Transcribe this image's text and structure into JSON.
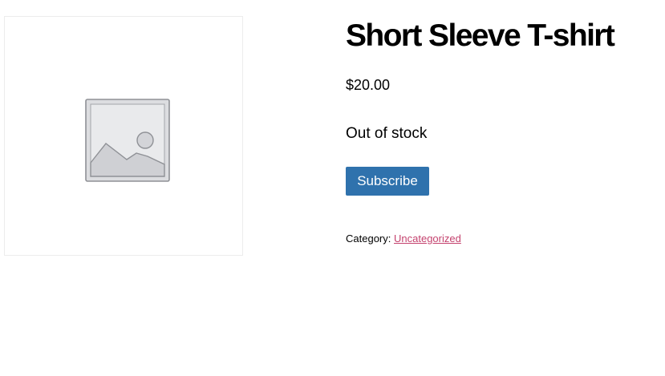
{
  "product": {
    "image_icon": "image-placeholder-icon",
    "title": "Short Sleeve T-shirt",
    "price": "$20.00",
    "stock_status": "Out of stock",
    "subscribe_label": "Subscribe",
    "category_label": "Category:",
    "category_link": "Uncategorized"
  },
  "colors": {
    "button_background": "#2f72ad",
    "button_text": "#ffffff",
    "link": "#c4426e",
    "placeholder_gray": "#d8d9dc"
  }
}
